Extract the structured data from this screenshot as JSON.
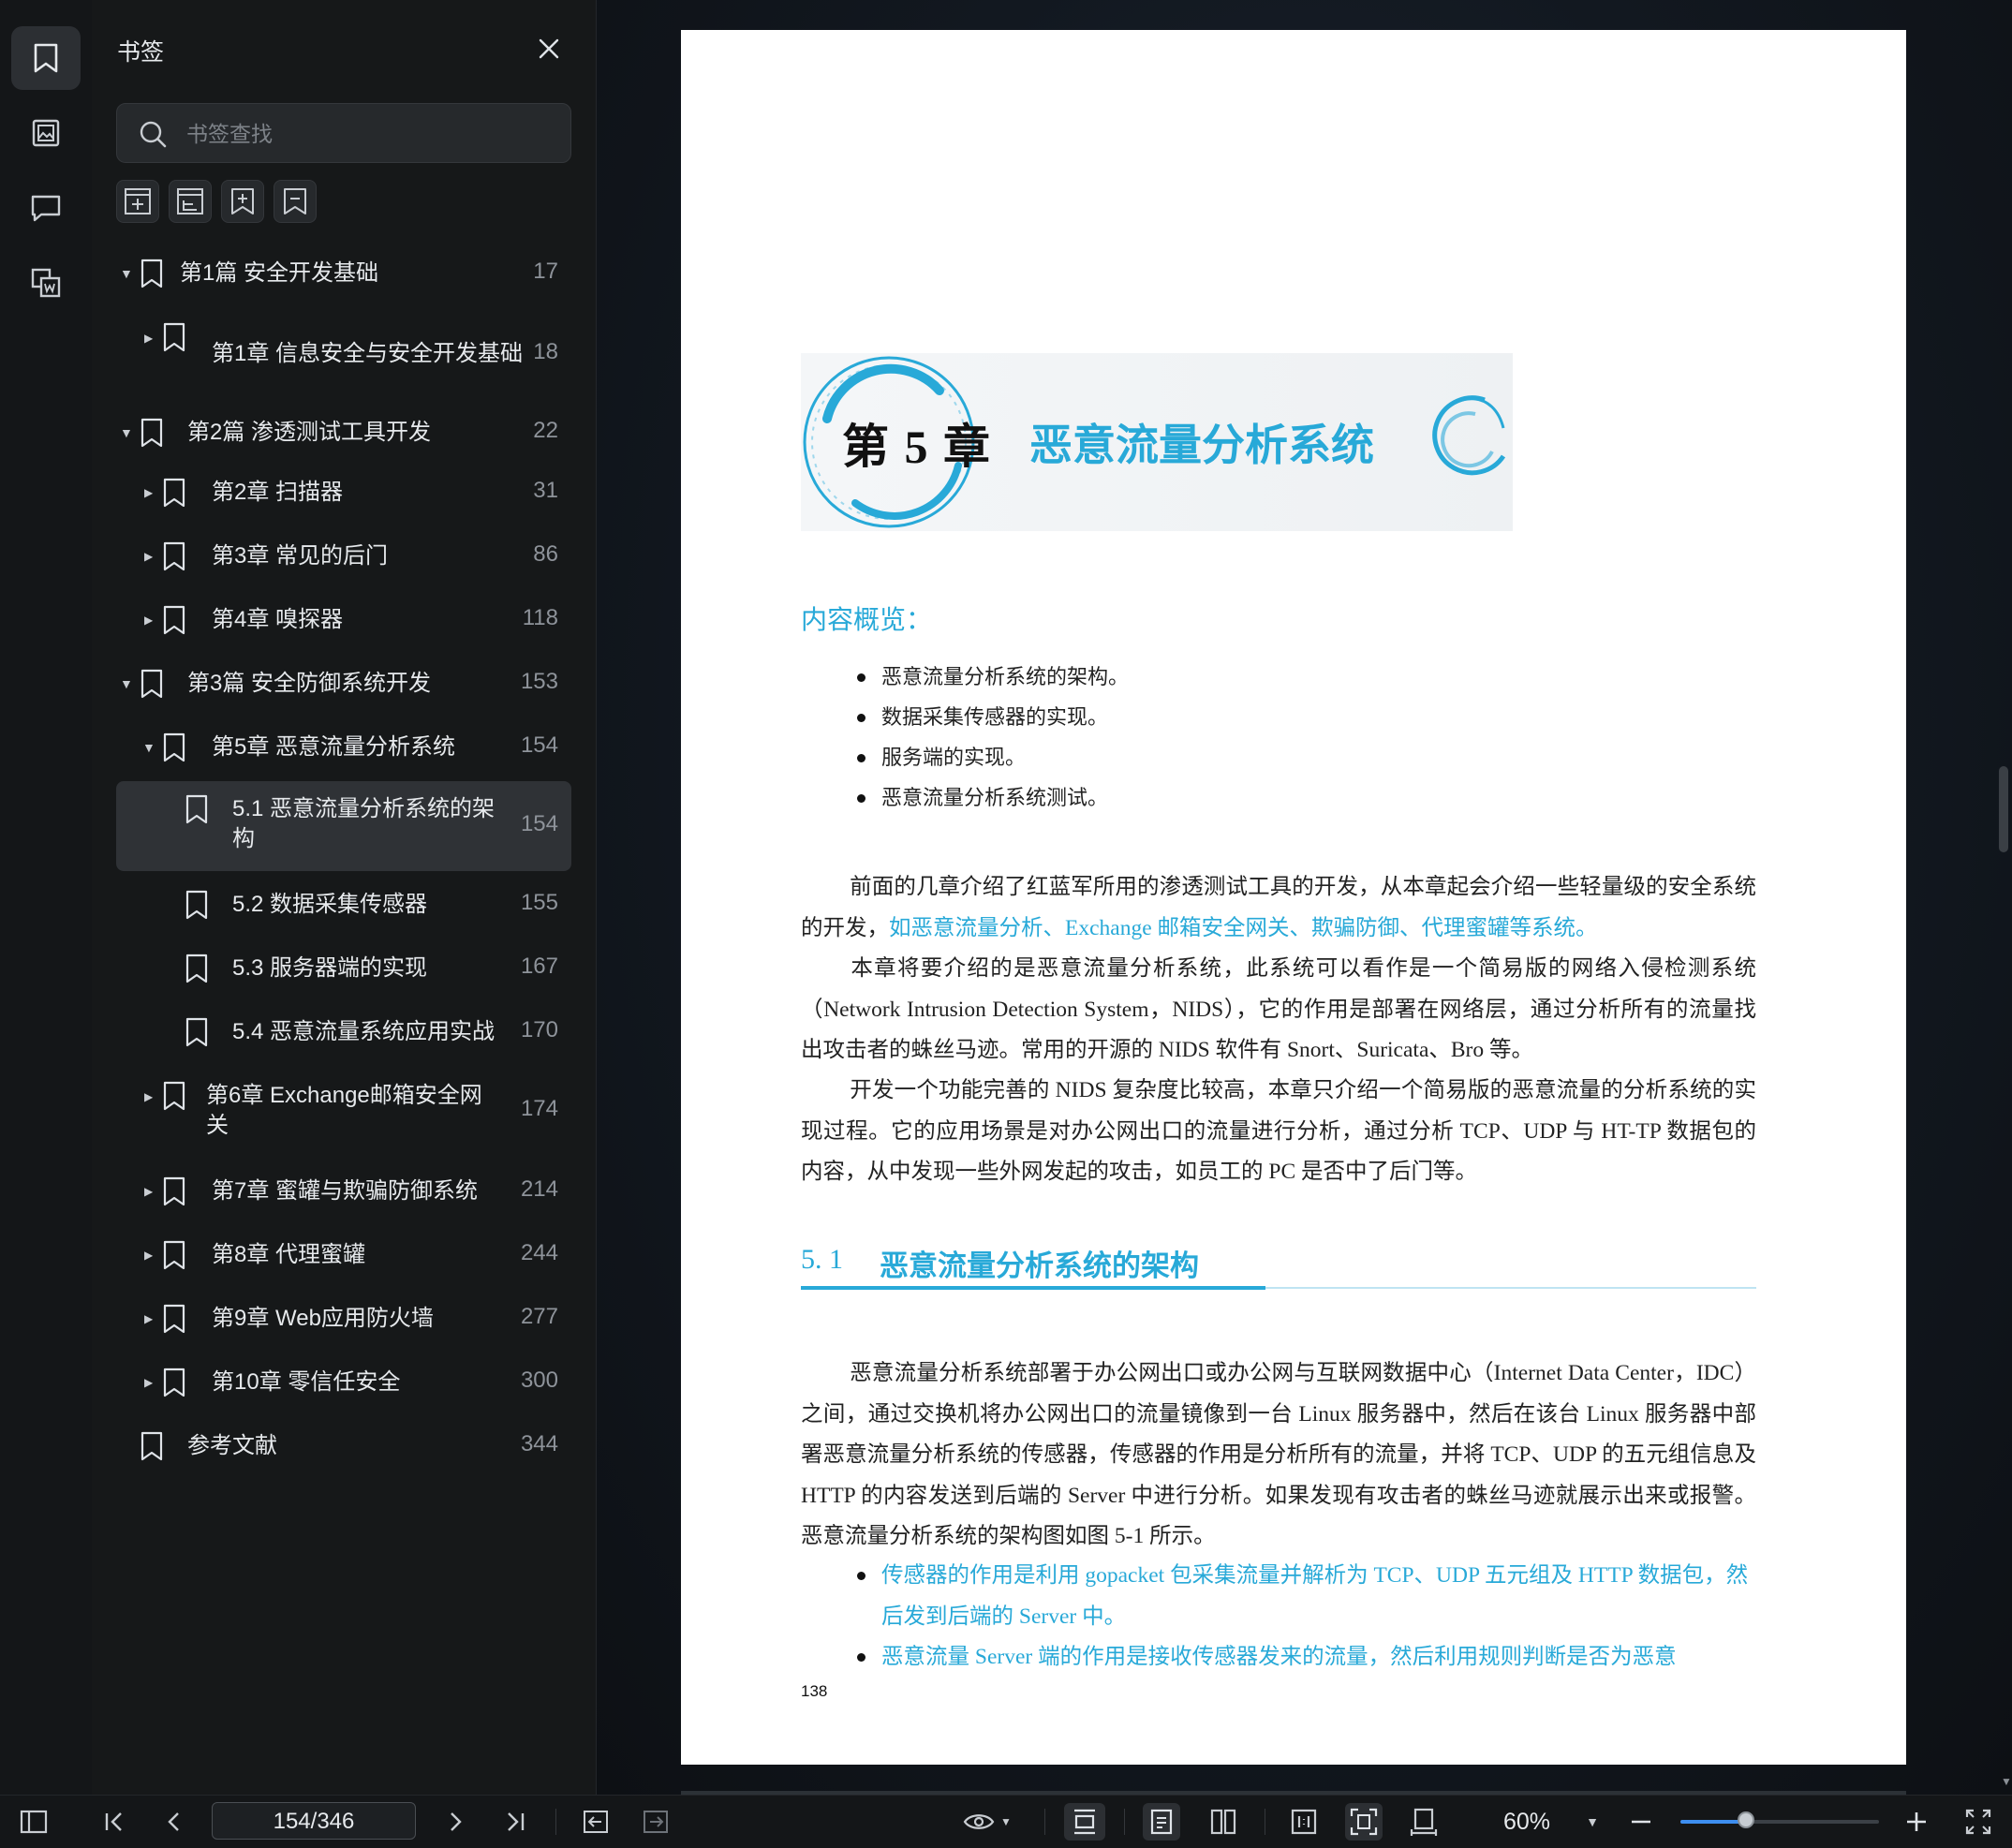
{
  "panel": {
    "title": "书签",
    "search_placeholder": "书签查找"
  },
  "bookmarks": [
    {
      "label": "第1篇 安全开发基础",
      "page": "17",
      "level": 0,
      "expanded": true
    },
    {
      "label": "第1章 信息安全与安全开发基础",
      "page": "18",
      "level": 1,
      "expanded": false
    },
    {
      "label": "第2篇 渗透测试工具开发",
      "page": "22",
      "level": 0,
      "expanded": true
    },
    {
      "label": "第2章 扫描器",
      "page": "31",
      "level": 1,
      "expanded": false
    },
    {
      "label": "第3章 常见的后门",
      "page": "86",
      "level": 1,
      "expanded": false
    },
    {
      "label": "第4章 嗅探器",
      "page": "118",
      "level": 1,
      "expanded": false
    },
    {
      "label": "第3篇 安全防御系统开发",
      "page": "153",
      "level": 0,
      "expanded": true
    },
    {
      "label": "第5章 恶意流量分析系统",
      "page": "154",
      "level": 1,
      "expanded": true
    },
    {
      "label": "5.1 恶意流量分析系统的架构",
      "page": "154",
      "level": 2,
      "selected": true
    },
    {
      "label": "5.2 数据采集传感器",
      "page": "155",
      "level": 2
    },
    {
      "label": "5.3 服务器端的实现",
      "page": "167",
      "level": 2
    },
    {
      "label": "5.4 恶意流量系统应用实战",
      "page": "170",
      "level": 2
    },
    {
      "label": "第6章 Exchange邮箱安全网关",
      "page": "174",
      "level": 1,
      "expanded": false
    },
    {
      "label": "第7章 蜜罐与欺骗防御系统",
      "page": "214",
      "level": 1,
      "expanded": false
    },
    {
      "label": "第8章 代理蜜罐",
      "page": "244",
      "level": 1,
      "expanded": false
    },
    {
      "label": "第9章 Web应用防火墙",
      "page": "277",
      "level": 1,
      "expanded": false
    },
    {
      "label": "第10章 零信任安全",
      "page": "300",
      "level": 1,
      "expanded": false
    },
    {
      "label": "参考文献",
      "page": "344",
      "level": 0
    }
  ],
  "document": {
    "chapter_number": "第 5 章",
    "chapter_title": "恶意流量分析系统",
    "overview_heading": "内容概览：",
    "overview_items": [
      "恶意流量分析系统的架构。",
      "数据采集传感器的实现。",
      "服务端的实现。",
      "恶意流量分析系统测试。"
    ],
    "para1_a": "前面的几章介绍了红蓝军所用的渗透测试工具的开发，从本章起会介绍一些轻量级的安全系统的开发，",
    "para1_b": "如恶意流量分析、Exchange 邮箱安全网关、欺骗防御、代理蜜罐等系统。",
    "para2": "本章将要介绍的是恶意流量分析系统，此系统可以看作是一个简易版的网络入侵检测系统（Network Intrusion Detection System，NIDS），它的作用是部署在网络层，通过分析所有的流量找出攻击者的蛛丝马迹。常用的开源的 NIDS 软件有 Snort、Suricata、Bro 等。",
    "para3": "开发一个功能完善的 NIDS 复杂度比较高，本章只介绍一个简易版的恶意流量的分析系统的实现过程。它的应用场景是对办公网出口的流量进行分析，通过分析 TCP、UDP 与 HT-TP 数据包的内容，从中发现一些外网发起的攻击，如员工的 PC 是否中了后门等。",
    "section_number": "5. 1",
    "section_title": "恶意流量分析系统的架构",
    "para4": "恶意流量分析系统部署于办公网出口或办公网与互联网数据中心（Internet Data Center，IDC）之间，通过交换机将办公网出口的流量镜像到一台 Linux 服务器中，然后在该台 Linux 服务器中部署恶意流量分析系统的传感器，传感器的作用是分析所有的流量，并将 TCP、UDP 的五元组信息及 HTTP 的内容发送到后端的 Server 中进行分析。如果发现有攻击者的蛛丝马迹就展示出来或报警。恶意流量分析系统的架构图如图 5-1 所示。",
    "bullet_a": "传感器的作用是利用 gopacket 包采集流量并解析为 TCP、UDP 五元组及 HTTP 数据包，然后发到后端的 Server 中。",
    "bullet_b": "恶意流量 Server 端的作用是接收传感器发来的流量，然后利用规则判断是否为恶意",
    "folio": "138"
  },
  "toolbar": {
    "page_indicator": "154/346",
    "zoom": "60%",
    "zoom_fraction": 0.33
  },
  "colors": {
    "accent": "#28a9d8",
    "panel_bg": "#161819",
    "selected_row": "#2f3236"
  }
}
